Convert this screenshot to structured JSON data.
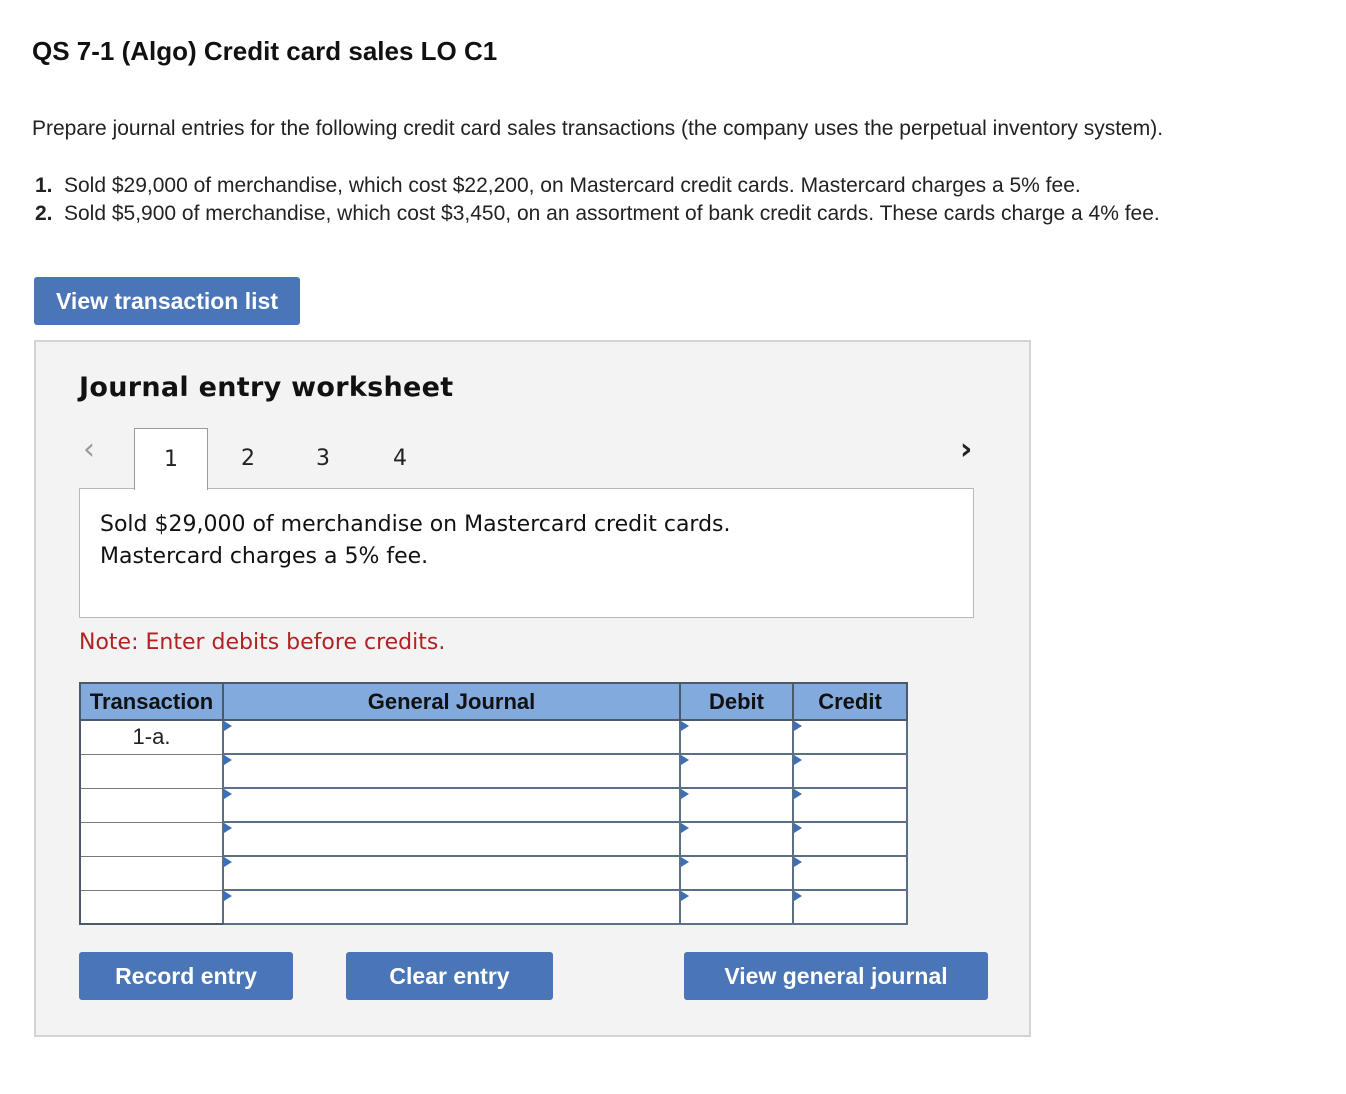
{
  "header": {
    "title": "QS 7-1 (Algo) Credit card sales LO C1",
    "intro": "Prepare journal entries for the following credit card sales transactions (the company uses the perpetual inventory system)."
  },
  "tasks": [
    {
      "num": "1.",
      "text": "Sold $29,000 of merchandise, which cost $22,200, on Mastercard credit cards. Mastercard charges a 5% fee."
    },
    {
      "num": "2.",
      "text": "Sold $5,900 of merchandise, which cost $3,450, on an assortment of bank credit cards. These cards charge a 4% fee."
    }
  ],
  "buttons": {
    "view_transaction_list": "View transaction list",
    "record_entry": "Record entry",
    "clear_entry": "Clear entry",
    "view_general_journal": "View general journal"
  },
  "worksheet": {
    "title": "Journal entry worksheet",
    "prev_icon": "chevron-left-icon",
    "next_icon": "chevron-right-icon",
    "tabs": [
      "1",
      "2",
      "3",
      "4"
    ],
    "active_tab": "1",
    "description_line1": "Sold $29,000 of merchandise on Mastercard credit cards.",
    "description_line2": "Mastercard charges a 5% fee.",
    "note": "Note: Enter debits before credits."
  },
  "journal": {
    "headers": {
      "transaction": "Transaction",
      "general_journal": "General Journal",
      "debit": "Debit",
      "credit": "Credit"
    },
    "rows": [
      {
        "transaction": "1-a.",
        "account": "",
        "debit": "",
        "credit": ""
      },
      {
        "transaction": "",
        "account": "",
        "debit": "",
        "credit": ""
      },
      {
        "transaction": "",
        "account": "",
        "debit": "",
        "credit": ""
      },
      {
        "transaction": "",
        "account": "",
        "debit": "",
        "credit": ""
      },
      {
        "transaction": "",
        "account": "",
        "debit": "",
        "credit": ""
      },
      {
        "transaction": "",
        "account": "",
        "debit": "",
        "credit": ""
      }
    ]
  },
  "colors": {
    "button_blue": "#4a76b8",
    "header_blue": "#82aadd",
    "note_red": "#b22222",
    "panel_gray": "#f3f3f3"
  }
}
